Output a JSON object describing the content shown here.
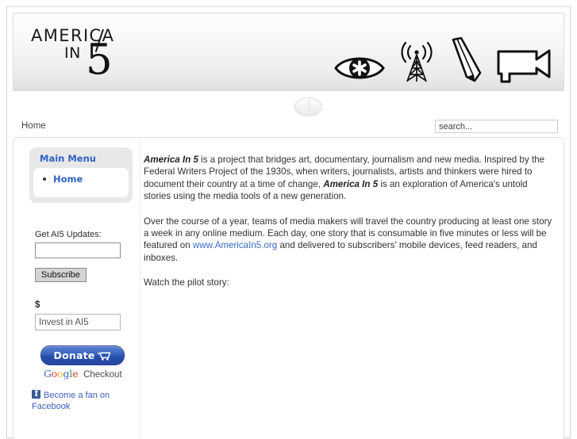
{
  "site": {
    "logo_line1": "AMERICA",
    "logo_line2": "IN",
    "logo_line3": "5",
    "header_icons": [
      {
        "name": "eye-asterisk-icon",
        "label": "eye"
      },
      {
        "name": "broadcast-tower-icon",
        "label": "radio tower"
      },
      {
        "name": "pencil-icon",
        "label": "pencil"
      },
      {
        "name": "video-camera-icon",
        "label": "video camera"
      }
    ]
  },
  "nav": {
    "breadcrumb": "Home"
  },
  "search": {
    "placeholder": "search...",
    "value": ""
  },
  "sidebar": {
    "menu": {
      "title": "Main Menu",
      "items": [
        {
          "label": "Home",
          "active": true
        }
      ]
    },
    "newsletter": {
      "label": "Get AI5 Updates:",
      "input_value": "",
      "input_placeholder": "",
      "button_label": "Subscribe"
    },
    "donate": {
      "currency_label": "$",
      "amount_placeholder": "Invest in AI5",
      "amount_value": "",
      "button_label": "Donate",
      "cart_icon": "shopping-cart-icon",
      "google_letters": [
        "G",
        "o",
        "o",
        "g",
        "l",
        "e"
      ],
      "checkout_label": "Checkout"
    },
    "social": {
      "facebook_icon": "facebook-icon",
      "facebook_label": "Become a fan on Facebook"
    }
  },
  "main": {
    "paragraphs": [
      {
        "runs": [
          {
            "text": "America In 5",
            "style": "bold"
          },
          {
            "text": " is a project that bridges art, documentary, journalism and new media. Inspired by the Federal Writers Project of the 1930s, when writers, journalists, artists and thinkers were hired to document their country at a time of change, ",
            "style": "normal"
          },
          {
            "text": "America In 5",
            "style": "bold"
          },
          {
            "text": " is an exploration of America's untold stories using the media tools of a new generation.",
            "style": "normal"
          }
        ]
      },
      {
        "runs": [
          {
            "text": "Over the course of a year, teams of media makers will travel the country producing at least one story a week in any online medium. Each day, one story that is consumable in five minutes or less will be featured on ",
            "style": "normal"
          },
          {
            "text": "www.AmericaIn5.org",
            "style": "link"
          },
          {
            "text": " and delivered to subscribers' mobile devices, feed readers, and inboxes.",
            "style": "normal"
          }
        ]
      },
      {
        "runs": [
          {
            "text": "Watch the pilot story:",
            "style": "normal"
          }
        ]
      }
    ]
  },
  "colors": {
    "link_blue": "#3a6cc6",
    "menu_blue": "#2f62c4",
    "donate_blue": "#2a4fae",
    "facebook_blue": "#3b5998"
  }
}
